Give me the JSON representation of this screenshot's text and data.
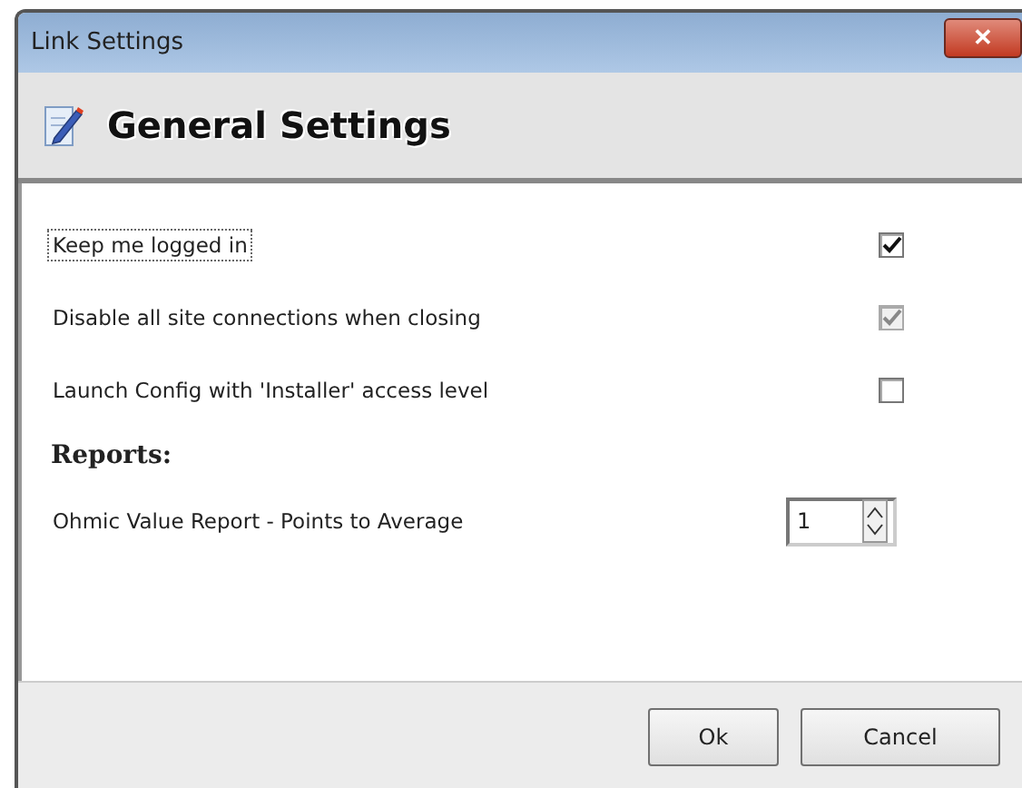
{
  "window": {
    "title": "Link Settings",
    "close": "✕"
  },
  "header": {
    "title": "General Settings"
  },
  "options": [
    {
      "label": "Keep me logged in",
      "checked": true,
      "disabled": false,
      "focused": true
    },
    {
      "label": "Disable all site connections when closing",
      "checked": true,
      "disabled": true,
      "focused": false
    },
    {
      "label": "Launch Config with 'Installer' access level",
      "checked": false,
      "disabled": false,
      "focused": false
    }
  ],
  "section": {
    "title": "Reports:"
  },
  "fields": [
    {
      "label": "Ohmic Value Report - Points to Average",
      "value": "1"
    }
  ],
  "buttons": [
    "Ok",
    "Cancel"
  ]
}
